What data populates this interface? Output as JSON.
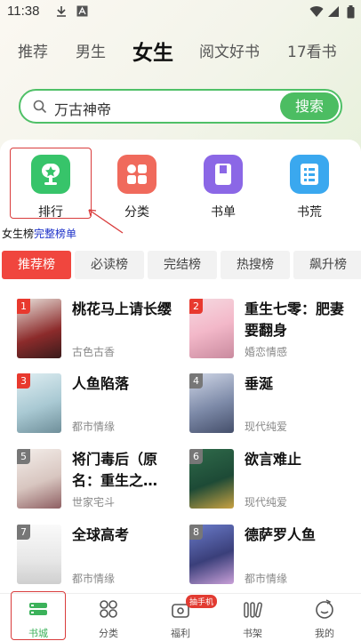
{
  "status": {
    "time": "11:38"
  },
  "channels": [
    "推荐",
    "男生",
    "女生",
    "阅文好书",
    "17看书"
  ],
  "search": {
    "query": "万古神帝",
    "button": "搜索"
  },
  "categories": [
    {
      "label": "排行",
      "icon": "trophy-icon",
      "color": "#37c46a"
    },
    {
      "label": "分类",
      "icon": "grid-icon",
      "color": "#f06a5c"
    },
    {
      "label": "书单",
      "icon": "book-icon",
      "color": "#8b67e6"
    },
    {
      "label": "书荒",
      "icon": "list-icon",
      "color": "#3aa8ef"
    }
  ],
  "note": {
    "prefix": "女生榜",
    "link": "完整榜单"
  },
  "rank_tabs": [
    "推荐榜",
    "必读榜",
    "完结榜",
    "热搜榜",
    "飙升榜"
  ],
  "books": [
    {
      "rank": "1",
      "title": "桃花马上请长缨",
      "genre": "古色古香"
    },
    {
      "rank": "2",
      "title": "重生七零：肥妻要翻身",
      "genre": "婚恋情感"
    },
    {
      "rank": "3",
      "title": "人鱼陷落",
      "genre": "都市情缘"
    },
    {
      "rank": "4",
      "title": "垂涎",
      "genre": "现代纯爱"
    },
    {
      "rank": "5",
      "title": "将门毒后（原名：重生之…",
      "genre": "世家宅斗"
    },
    {
      "rank": "6",
      "title": "欲言难止",
      "genre": "现代纯爱"
    },
    {
      "rank": "7",
      "title": "全球高考",
      "genre": "都市情缘"
    },
    {
      "rank": "8",
      "title": "德萨罗人鱼",
      "genre": "都市情缘"
    }
  ],
  "nav": [
    {
      "label": "书城",
      "icon": "bookstore-icon"
    },
    {
      "label": "分类",
      "icon": "category-icon"
    },
    {
      "label": "福利",
      "icon": "gift-icon"
    },
    {
      "label": "书架",
      "icon": "bookshelf-icon"
    },
    {
      "label": "我的",
      "icon": "profile-icon"
    }
  ],
  "nav_badge": "抽手机",
  "colors": {
    "accent": "#4cbd62",
    "rank_tab_active": "#f0463e"
  }
}
